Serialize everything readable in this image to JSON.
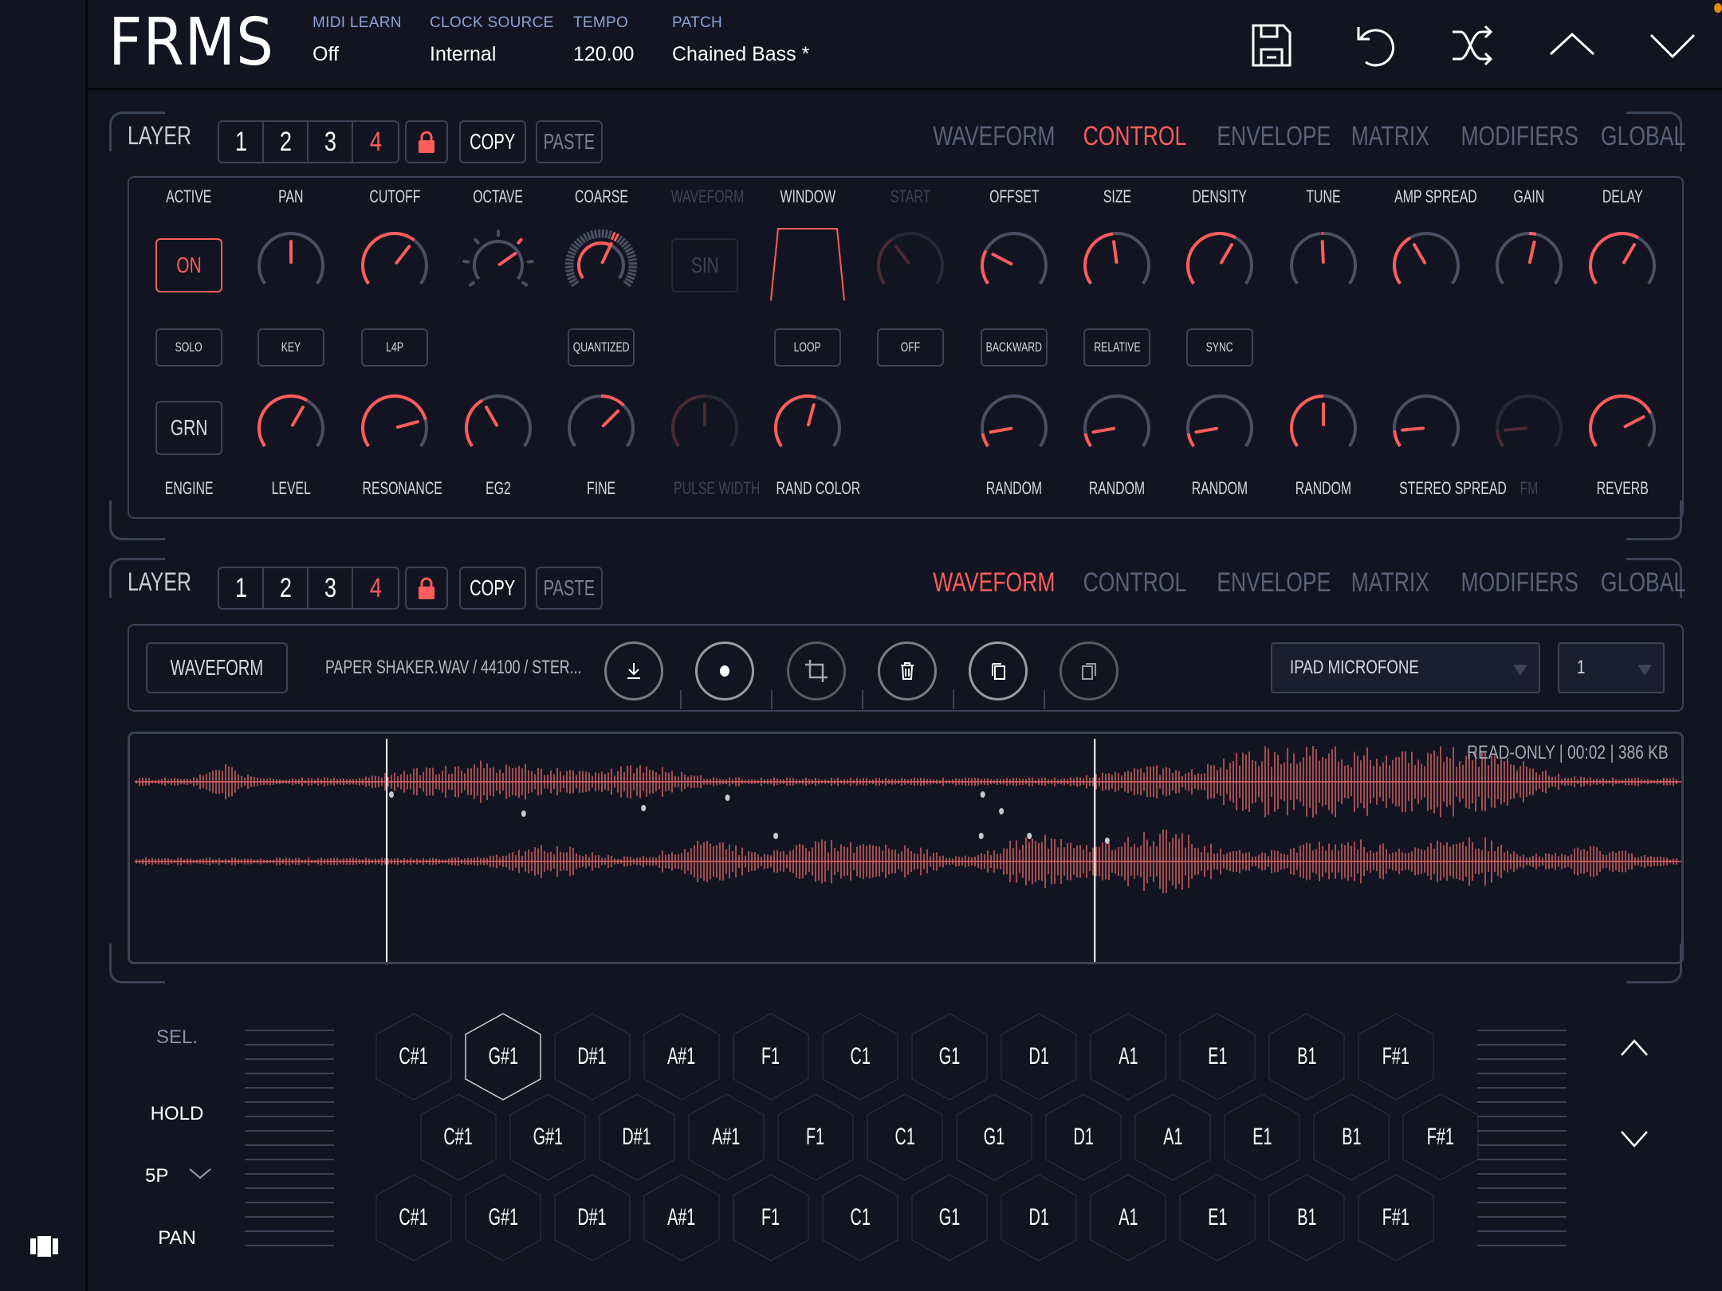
{
  "app": {
    "title": "FRMS"
  },
  "header": {
    "fields": [
      {
        "label": "MIDI LEARN",
        "value": "Off"
      },
      {
        "label": "CLOCK SOURCE",
        "value": "Internal"
      },
      {
        "label": "TEMPO",
        "value": "120.00"
      },
      {
        "label": "PATCH",
        "value": "Chained Bass *"
      }
    ],
    "icons": [
      "save-icon",
      "undo-icon",
      "shuffle-icon",
      "chevron-up-icon",
      "chevron-down-icon"
    ]
  },
  "colors": {
    "accent": "#ff5c5c",
    "background": "#121521",
    "border": "#3b4256",
    "muted": "#5b6178",
    "header_label": "#8aa2d6"
  },
  "layer_panels": [
    {
      "label": "LAYER",
      "layers": [
        "1",
        "2",
        "3",
        "4"
      ],
      "selected_layer": "4",
      "lock_icon": "lock-icon",
      "copy_label": "COPY",
      "paste_label": "PASTE",
      "tabs": [
        "WAVEFORM",
        "CONTROL",
        "ENVELOPE",
        "MATRIX",
        "MODIFIERS",
        "GLOBAL"
      ],
      "active_tab": "CONTROL"
    },
    {
      "label": "LAYER",
      "layers": [
        "1",
        "2",
        "3",
        "4"
      ],
      "selected_layer": "4",
      "lock_icon": "lock-icon",
      "copy_label": "COPY",
      "paste_label": "PASTE",
      "tabs": [
        "WAVEFORM",
        "CONTROL",
        "ENVELOPE",
        "MATRIX",
        "MODIFIERS",
        "GLOBAL"
      ],
      "active_tab": "WAVEFORM"
    }
  ],
  "control": {
    "top_labels": [
      "ACTIVE",
      "PAN",
      "CUTOFF",
      "OCTAVE",
      "COARSE",
      "WAVEFORM",
      "WINDOW",
      "START",
      "OFFSET",
      "SIZE",
      "DENSITY",
      "TUNE",
      "AMP SPREAD",
      "GAIN",
      "DELAY"
    ],
    "top_disabled": [
      false,
      false,
      false,
      false,
      false,
      true,
      false,
      true,
      false,
      false,
      false,
      false,
      false,
      false,
      false
    ],
    "active_button": "ON",
    "waveform_button": "SIN",
    "top_knobs": [
      {
        "name": "pan",
        "value": 0.5,
        "bipolar": true
      },
      {
        "name": "cutoff",
        "value": 0.65
      },
      {
        "name": "octave",
        "value": 0.72,
        "stepped": true
      },
      {
        "name": "coarse",
        "value": 0.6,
        "quantized": true
      },
      {
        "name": "start",
        "value": 0.35,
        "disabled": true
      },
      {
        "name": "offset",
        "value": 0.25
      },
      {
        "name": "size",
        "value": 0.47
      },
      {
        "name": "density",
        "value": 0.62
      },
      {
        "name": "tune",
        "value": 0.49,
        "bipolar": true
      },
      {
        "name": "amp-spread",
        "value": 0.38
      },
      {
        "name": "gain",
        "value": 0.55,
        "bipolar": true
      },
      {
        "name": "delay",
        "value": 0.62
      }
    ],
    "mid_buttons": [
      {
        "col": 0,
        "label": "SOLO"
      },
      {
        "col": 1,
        "label": "KEY"
      },
      {
        "col": 2,
        "label": "L4P"
      },
      {
        "col": 4,
        "label": "QUANTIZED"
      },
      {
        "col": 6,
        "label": "LOOP"
      },
      {
        "col": 7,
        "label": "OFF"
      },
      {
        "col": 8,
        "label": "BACKWARD"
      },
      {
        "col": 9,
        "label": "RELATIVE"
      },
      {
        "col": 10,
        "label": "SYNC"
      }
    ],
    "engine_button": "GRN",
    "bottom_knobs": [
      {
        "col": 1,
        "name": "level",
        "value": 0.62
      },
      {
        "col": 2,
        "name": "resonance",
        "value": 0.8
      },
      {
        "col": 3,
        "name": "eg2",
        "value": 0.38
      },
      {
        "col": 4,
        "name": "fine",
        "value": 0.68,
        "bipolar": true
      },
      {
        "col": 5,
        "name": "pulse-width",
        "value": 0.5,
        "disabled": true
      },
      {
        "col": 6,
        "name": "rand-color",
        "value": 0.56
      },
      {
        "col": 8,
        "name": "random-1",
        "value": 0.1
      },
      {
        "col": 9,
        "name": "random-2",
        "value": 0.1
      },
      {
        "col": 10,
        "name": "random-3",
        "value": 0.1
      },
      {
        "col": 11,
        "name": "random-4",
        "value": 0.5
      },
      {
        "col": 12,
        "name": "stereo-spread",
        "value": 0.12
      },
      {
        "col": 13,
        "name": "fm",
        "value": 0.12,
        "disabled": true
      },
      {
        "col": 14,
        "name": "reverb",
        "value": 0.75
      }
    ],
    "bottom_labels": [
      "ENGINE",
      "LEVEL",
      "RESONANCE",
      "EG2",
      "FINE",
      "PULSE WIDTH",
      "RAND COLOR",
      "",
      "RANDOM",
      "RANDOM",
      "RANDOM",
      "RANDOM",
      "STEREO SPREAD",
      "FM",
      "REVERB"
    ],
    "bottom_disabled": [
      false,
      false,
      false,
      false,
      false,
      true,
      false,
      false,
      false,
      false,
      false,
      false,
      false,
      true,
      false
    ]
  },
  "waveform": {
    "mode_button": "WAVEFORM",
    "file_info": "PAPER SHAKER.WAV / 44100 / STER...",
    "tool_icons": [
      "download-icon",
      "record-icon",
      "crop-icon",
      "trash-icon",
      "copy-icon",
      "paste-icon"
    ],
    "input_source": "IPAD MICROFONE",
    "channel": "1",
    "info": "READ-ONLY  |  00:02  |  386 KB",
    "selection_start": 0.165,
    "selection_end": 0.62
  },
  "keyboard": {
    "sel_label": "SEL.",
    "hold_label": "HOLD",
    "poly_label": "5P",
    "pan_label": "PAN",
    "rows": [
      [
        "C#1",
        "G#1",
        "D#1",
        "A#1",
        "F1",
        "C1",
        "G1",
        "D1",
        "A1",
        "E1",
        "B1",
        "F#1"
      ],
      [
        "C#1",
        "G#1",
        "D#1",
        "A#1",
        "F1",
        "C1",
        "G1",
        "D1",
        "A1",
        "E1",
        "B1",
        "F#1"
      ],
      [
        "C#1",
        "G#1",
        "D#1",
        "A#1",
        "F1",
        "C1",
        "G1",
        "D1",
        "A1",
        "E1",
        "B1",
        "F#1"
      ]
    ],
    "highlighted": {
      "row": 0,
      "col": 1
    }
  }
}
